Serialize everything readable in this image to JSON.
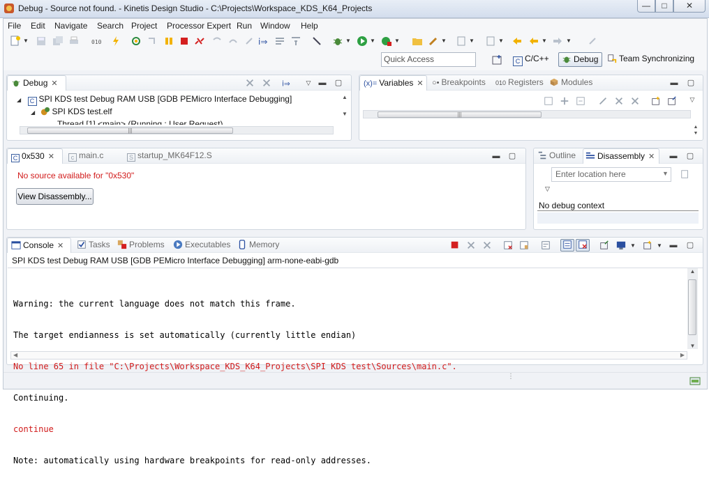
{
  "window": {
    "title": "Debug - Source not found. - Kinetis Design Studio - C:\\Projects\\Workspace_KDS_K64_Projects",
    "min": "—",
    "max": "□",
    "close": "✕"
  },
  "menu": [
    "File",
    "Edit",
    "Navigate",
    "Search",
    "Project",
    "Processor Expert",
    "Run",
    "Window",
    "Help"
  ],
  "quick_access": {
    "placeholder": "Quick Access"
  },
  "perspectives": {
    "c_cpp": "C/C++",
    "debug": "Debug",
    "team": "Team Synchronizing"
  },
  "debug_view": {
    "tab": "Debug",
    "launch": "SPI KDS test Debug RAM USB [GDB PEMicro Interface Debugging]",
    "elf": "SPI KDS test.elf",
    "thread": "Thread [1] <main> (Running : User Request)"
  },
  "variables_view": {
    "tabs": [
      "Variables",
      "Breakpoints",
      "Registers",
      "Modules"
    ]
  },
  "editor": {
    "tabs": [
      "0x530",
      "main.c",
      "startup_MK64F12.S"
    ],
    "message": "No source available for \"0x530\"",
    "button": "View Disassembly..."
  },
  "outline_view": {
    "tabs": [
      "Outline",
      "Disassembly"
    ],
    "location_placeholder": "Enter location here",
    "context": "No debug context"
  },
  "console_view": {
    "tabs": [
      "Console",
      "Tasks",
      "Problems",
      "Executables",
      "Memory"
    ],
    "header": "SPI KDS test Debug RAM USB [GDB PEMicro Interface Debugging] arm-none-eabi-gdb",
    "lines": [
      {
        "text": "Warning: the current language does not match this frame.",
        "color": "normal"
      },
      {
        "text": "The target endianness is set automatically (currently little endian)",
        "color": "normal"
      },
      {
        "text": "No line 65 in file \"C:\\Projects\\Workspace_KDS_K64_Projects\\SPI KDS test\\Sources\\main.c\".",
        "color": "red"
      },
      {
        "text": "Continuing.",
        "color": "normal"
      },
      {
        "text": "continue",
        "color": "red"
      },
      {
        "text": "Note: automatically using hardware breakpoints for read-only addresses.",
        "color": "normal"
      }
    ]
  },
  "colors": {
    "accent": "#d11a1a",
    "frame": "#f0f2f6"
  }
}
